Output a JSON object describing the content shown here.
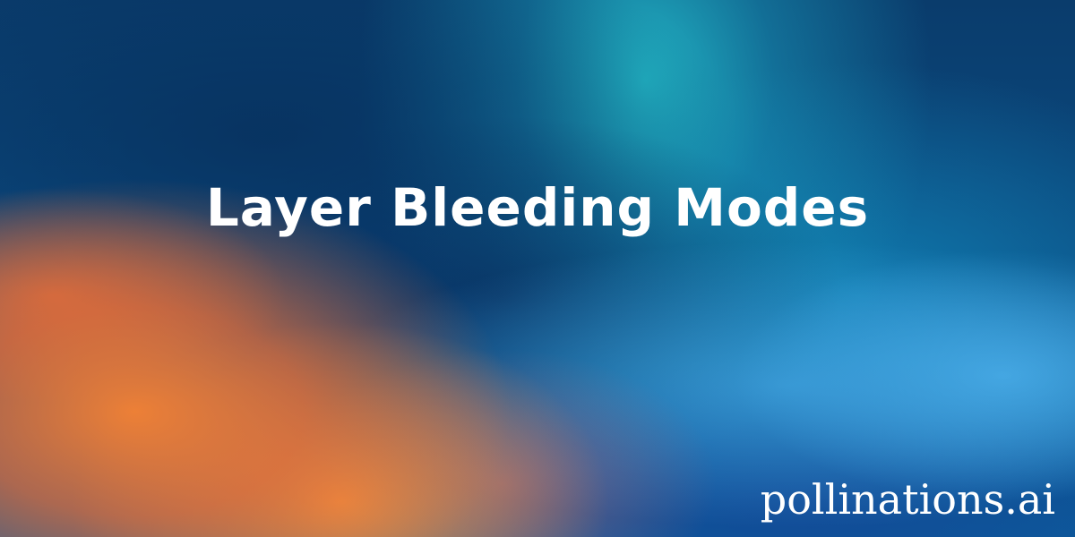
{
  "title": "Layer Bleeding Modes",
  "watermark": "pollinations.ai",
  "colors": {
    "deep_blue": "#0a3f72",
    "cyan_glow": "#26c8d2",
    "light_blue": "#50b4f0",
    "orange": "#f88232",
    "text": "#ffffff"
  }
}
